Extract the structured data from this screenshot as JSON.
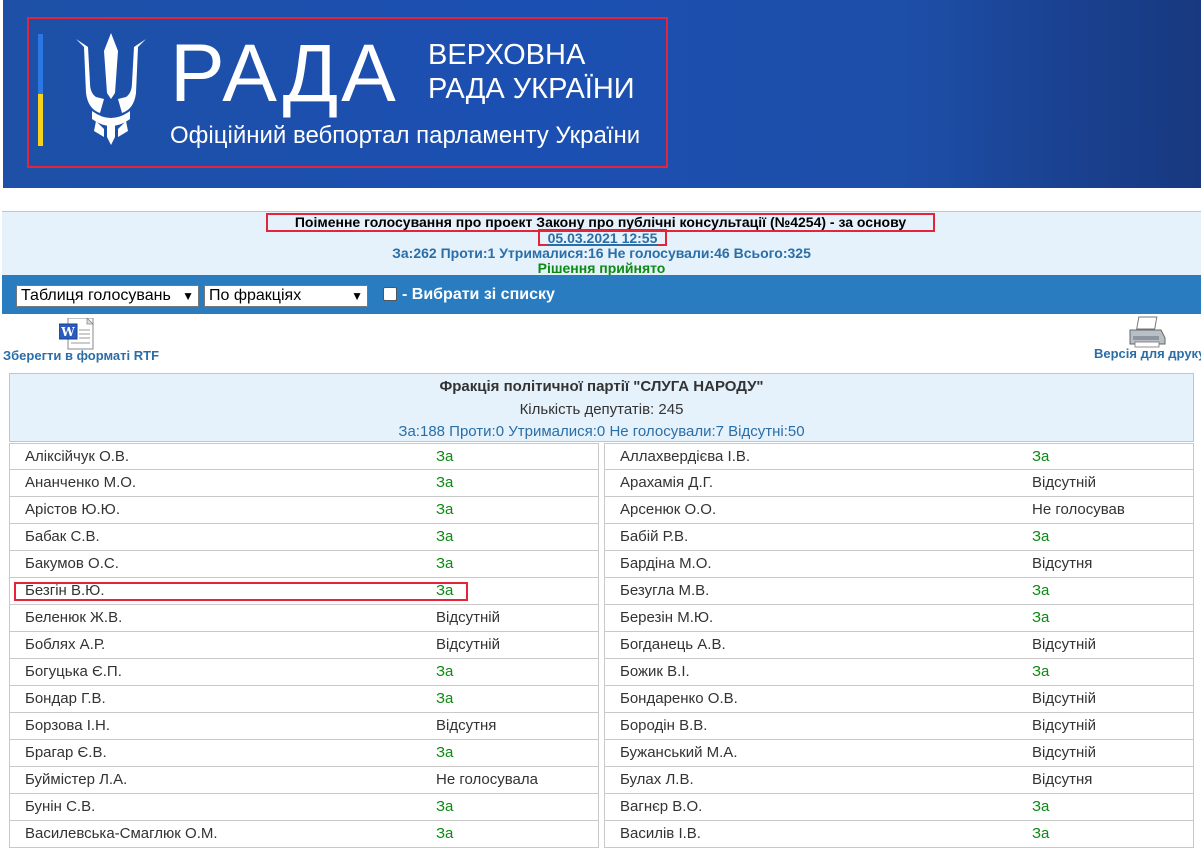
{
  "header": {
    "brand": "РАДА",
    "title_line1": "ВЕРХОВНА",
    "title_line2": "РАДА УКРАЇНИ",
    "subtitle": "Офіційний вебпортал парламенту України",
    "colors": {
      "banner": "#1d50a6",
      "flag_blue": "#2b78e4",
      "flag_yellow": "#f5d31c"
    }
  },
  "vote": {
    "title": "Поіменне голосування про проект Закону про публічні консультації (№4254) - за основу",
    "datetime": "05.03.2021 12:55",
    "counts": "За:262 Проти:1 Утрималися:16 Не голосували:46 Всього:325",
    "result": "Рішення прийнято"
  },
  "toolbar": {
    "view_select": "Таблиця голосувань",
    "group_select": "По фракціях",
    "choose_label": "- Вибрати зі списку",
    "choose_checked": false
  },
  "exports": {
    "rtf_label": "Зберегти в форматі RTF",
    "rtf_icon": "word-document-icon",
    "print_label": "Версія для друку",
    "print_icon": "printer-icon"
  },
  "faction": {
    "name": "Фракція політичної партії \"СЛУГА НАРОДУ\"",
    "members": "Кількість депутатів: 245",
    "votes": "За:188 Проти:0 Утрималися:0 Не голосували:7 Відсутні:50"
  },
  "deputies_left": [
    {
      "name": "Аліксійчук О.В.",
      "vote": "За"
    },
    {
      "name": "Ананченко М.О.",
      "vote": "За"
    },
    {
      "name": "Арістов Ю.Ю.",
      "vote": "За"
    },
    {
      "name": "Бабак С.В.",
      "vote": "За"
    },
    {
      "name": "Бакумов О.С.",
      "vote": "За"
    },
    {
      "name": "Безгін В.Ю.",
      "vote": "За"
    },
    {
      "name": "Беленюк Ж.В.",
      "vote": "Відсутній"
    },
    {
      "name": "Боблях А.Р.",
      "vote": "Відсутній"
    },
    {
      "name": "Богуцька Є.П.",
      "vote": "За"
    },
    {
      "name": "Бондар Г.В.",
      "vote": "За"
    },
    {
      "name": "Борзова І.Н.",
      "vote": "Відсутня"
    },
    {
      "name": "Брагар Є.В.",
      "vote": "За"
    },
    {
      "name": "Буймістер Л.А.",
      "vote": "Не голосувала"
    },
    {
      "name": "Бунін С.В.",
      "vote": "За"
    },
    {
      "name": "Василевська-Смаглюк О.М.",
      "vote": "За"
    }
  ],
  "deputies_right": [
    {
      "name": "Аллахвердієва І.В.",
      "vote": "За"
    },
    {
      "name": "Арахамія Д.Г.",
      "vote": "Відсутній"
    },
    {
      "name": "Арсенюк О.О.",
      "vote": "Не голосував"
    },
    {
      "name": "Бабій Р.В.",
      "vote": "За"
    },
    {
      "name": "Бардіна М.О.",
      "vote": "Відсутня"
    },
    {
      "name": "Безугла М.В.",
      "vote": "За"
    },
    {
      "name": "Березін М.Ю.",
      "vote": "За"
    },
    {
      "name": "Богданець А.В.",
      "vote": "Відсутній"
    },
    {
      "name": "Божик В.І.",
      "vote": "За"
    },
    {
      "name": "Бондаренко О.В.",
      "vote": "Відсутній"
    },
    {
      "name": "Бородін В.В.",
      "vote": "Відсутній"
    },
    {
      "name": "Бужанський М.А.",
      "vote": "Відсутній"
    },
    {
      "name": "Булах Л.В.",
      "vote": "Відсутня"
    },
    {
      "name": "Вагнєр В.О.",
      "vote": "За"
    },
    {
      "name": "Василів І.В.",
      "vote": "За"
    }
  ],
  "highlighted_row": "Безгін В.Ю."
}
